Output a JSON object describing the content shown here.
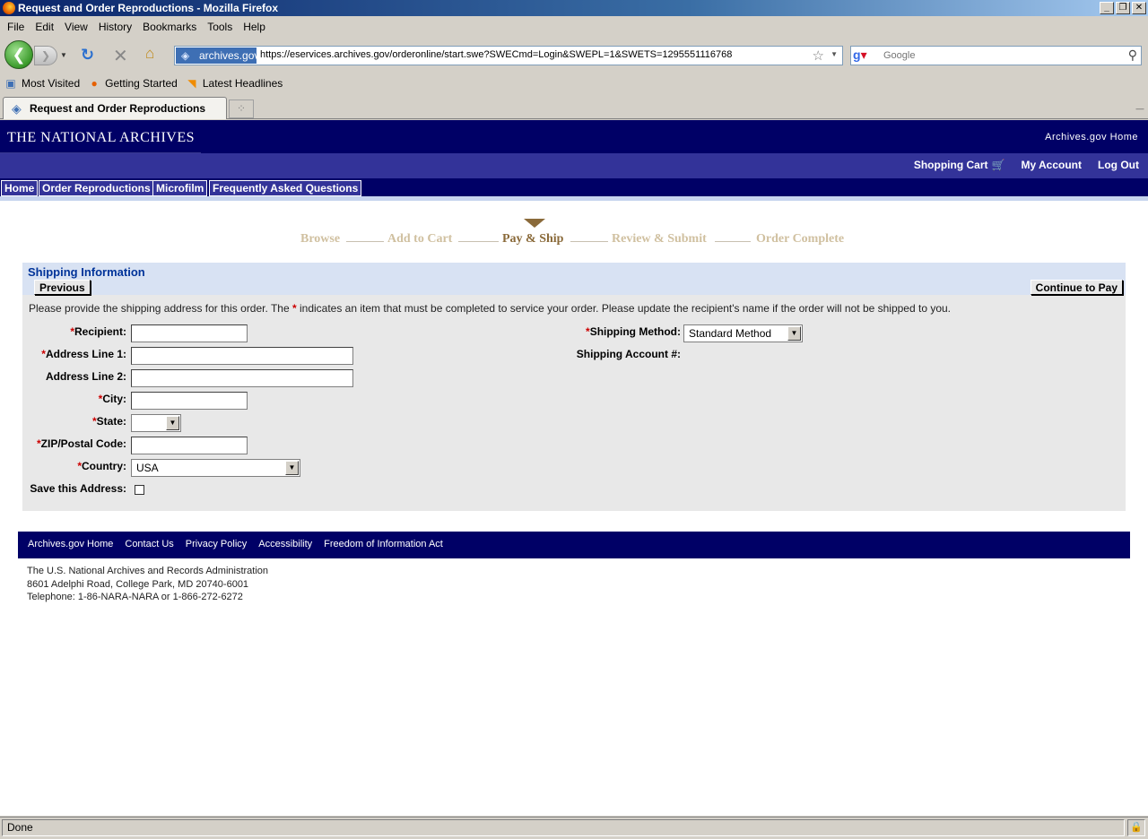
{
  "window": {
    "title": "Request and Order Reproductions - Mozilla Firefox"
  },
  "menu": [
    "File",
    "Edit",
    "View",
    "History",
    "Bookmarks",
    "Tools",
    "Help"
  ],
  "toolbar": {
    "site_badge": "archives.gov",
    "url": "https://eservices.archives.gov/orderonline/start.swe?SWECmd=Login&SWEPL=1&SWETS=1295551116768",
    "search_placeholder": "Google"
  },
  "bookmarks": [
    "Most Visited",
    "Getting Started",
    "Latest Headlines"
  ],
  "tab": {
    "label": "Request and Order Reproductions"
  },
  "site": {
    "logo": "THE NATIONAL ARCHIVES",
    "home_link": "Archives.gov Home",
    "account_links": [
      "Shopping Cart",
      "My Account",
      "Log Out"
    ],
    "nav_tabs": [
      "Home",
      "Order Reproductions",
      "Microfilm",
      "Frequently Asked Questions"
    ]
  },
  "steps": {
    "items": [
      "Browse",
      "Add to Cart",
      "Pay & Ship",
      "Review & Submit",
      "Order Complete"
    ],
    "active": "Pay & Ship"
  },
  "form": {
    "title": "Shipping Information",
    "previous_label": "Previous",
    "continue_label": "Continue to Pay",
    "required_marker": "*",
    "instructions_before": "Please provide the shipping address for this order. The",
    "instructions_after": "indicates an item that must be completed to service your order. Please update the recipient's name if the order will not be shipped to you.",
    "fields": {
      "recipient": {
        "label": "Recipient:",
        "value": ""
      },
      "address1": {
        "label": "Address Line 1:",
        "value": ""
      },
      "address2": {
        "label": "Address Line 2:",
        "value": ""
      },
      "city": {
        "label": "City:",
        "value": ""
      },
      "state": {
        "label": "State:",
        "value": ""
      },
      "zip": {
        "label": "ZIP/Postal Code:",
        "value": ""
      },
      "country": {
        "label": "Country:",
        "value": "USA"
      },
      "save": {
        "label": "Save this Address:",
        "checked": false
      },
      "shipping_method": {
        "label": "Shipping Method:",
        "value": "Standard Method"
      },
      "shipping_account": {
        "label": "Shipping Account #:"
      }
    }
  },
  "footer": {
    "links": [
      "Archives.gov Home",
      "Contact Us",
      "Privacy Policy",
      "Accessibility",
      "Freedom of Information Act"
    ],
    "address_lines": [
      "The U.S. National Archives and Records Administration",
      "8601 Adelphi Road, College Park, MD 20740-6001",
      "Telephone: 1-86-NARA-NARA or 1-866-272-6272"
    ]
  },
  "status": {
    "text": "Done"
  },
  "colors": {
    "header_navy": "#000066",
    "subheader_blue": "#333399",
    "panel_head": "#d8e2f3",
    "required_red": "#cc0000",
    "step_active": "#8a6a3a"
  }
}
